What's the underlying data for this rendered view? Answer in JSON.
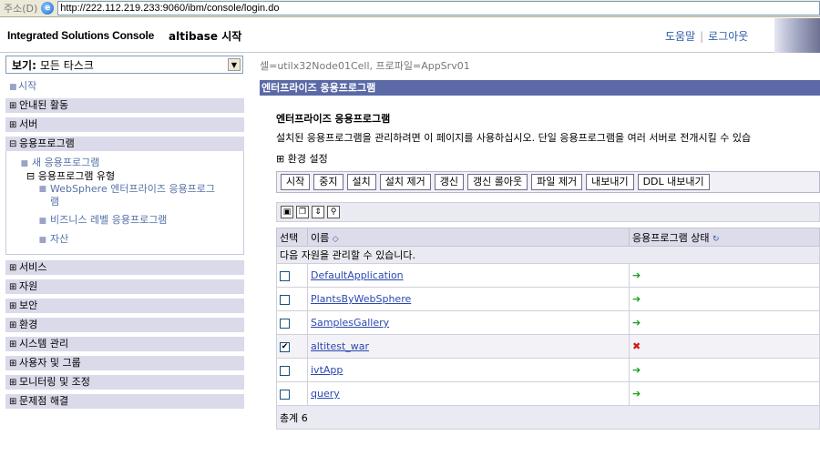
{
  "address_bar": {
    "label": "주소(D)",
    "url": "http://222.112.219.233:9060/ibm/console/login.do"
  },
  "header": {
    "brand": "Integrated Solutions Console",
    "subtitle": "altibase 시작",
    "help": "도움말",
    "separator": "|",
    "logout": "로그아웃"
  },
  "nav": {
    "view_label": "보기:",
    "view_value": "모든 타스크",
    "items": [
      {
        "toggle": "",
        "label": "시작",
        "style": "plain"
      },
      {
        "toggle": "⊞",
        "label": "안내된 활동"
      },
      {
        "toggle": "⊞",
        "label": "서버"
      },
      {
        "toggle": "⊟",
        "label": "응용프로그램"
      }
    ],
    "app_sub": {
      "new_app": "새 응용프로그램",
      "app_type_toggle": "⊟",
      "app_type": "응용프로그램 유형",
      "websphere": "WebSphere 엔터프라이즈 응용프로그램",
      "business": "비즈니스 레벨 응용프로그램",
      "assets": "자산"
    },
    "items2": [
      {
        "toggle": "⊞",
        "label": "서비스"
      },
      {
        "toggle": "⊞",
        "label": "자원"
      },
      {
        "toggle": "⊞",
        "label": "보안"
      },
      {
        "toggle": "⊞",
        "label": "환경"
      },
      {
        "toggle": "⊞",
        "label": "시스템 관리"
      },
      {
        "toggle": "⊞",
        "label": "사용자 및 그룹"
      },
      {
        "toggle": "⊞",
        "label": "모니터링 및 조정"
      },
      {
        "toggle": "⊞",
        "label": "문제점 해결"
      }
    ]
  },
  "content": {
    "cell_info": "셀=utilx32Node01Cell, 프로파일=AppSrv01",
    "bar_title": "엔터프라이즈 응용프로그램",
    "section_title": "엔터프라이즈 응용프로그램",
    "description": "설치된 응용프로그램을 관리하려면 이 페이지를 사용하십시오. 단일 응용프로그램을 여러 서버로 전개시킬 수 있습",
    "env_toggle": "⊞",
    "env_label": "환경 설정",
    "buttons": [
      "시작",
      "중지",
      "설치",
      "설치 제거",
      "갱신",
      "갱신 롤아웃",
      "파일 제거",
      "내보내기",
      "DDL 내보내기"
    ],
    "table": {
      "col_select": "선택",
      "col_name": "이름",
      "col_status": "응용프로그램 상태",
      "message": "다음 자원을 관리할 수 있습니다.",
      "rows": [
        {
          "name": "DefaultApplication",
          "checked": "",
          "status": "➔",
          "status_kind": "started"
        },
        {
          "name": "PlantsByWebSphere",
          "checked": "",
          "status": "➔",
          "status_kind": "started"
        },
        {
          "name": "SamplesGallery",
          "checked": "",
          "status": "➔",
          "status_kind": "started"
        },
        {
          "name": "altitest_war",
          "checked": "✔",
          "status": "✖",
          "status_kind": "stopped"
        },
        {
          "name": "ivtApp",
          "checked": "",
          "status": "➔",
          "status_kind": "started"
        },
        {
          "name": "query",
          "checked": "",
          "status": "➔",
          "status_kind": "started"
        }
      ],
      "total_label": "총계",
      "total_value": "6"
    }
  }
}
